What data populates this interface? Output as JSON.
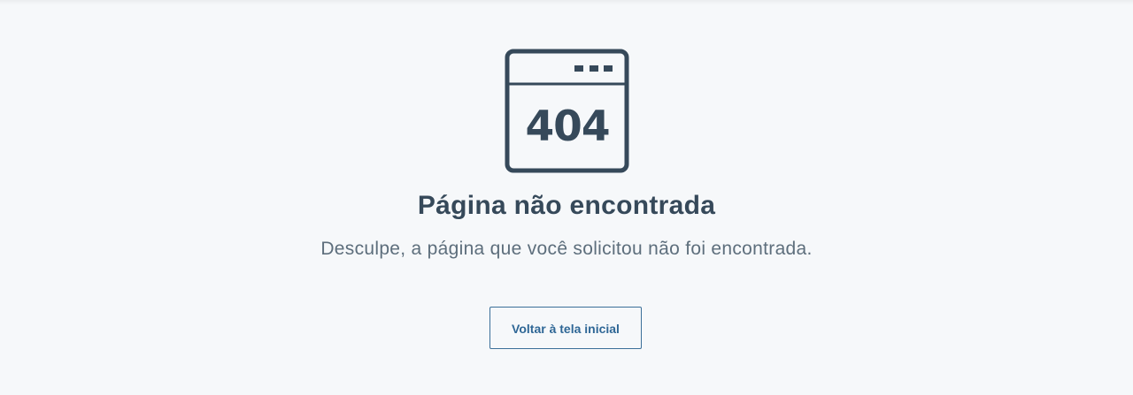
{
  "illustration": {
    "icon": "browser-404-icon",
    "text": "404",
    "color": "#36495a"
  },
  "page": {
    "title": "Página não encontrada",
    "subtitle": "Desculpe, a página que você solicitou não foi encontrada.",
    "home_button_label": "Voltar à tela inicial"
  },
  "colors": {
    "background": "#f6f8fa",
    "title": "#36495a",
    "subtitle": "#5d6e7c",
    "button_border": "#3b6f99",
    "button_text": "#2f6796"
  }
}
